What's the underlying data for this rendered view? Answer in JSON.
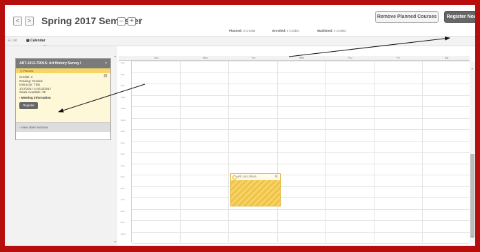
{
  "header": {
    "prev_label": "<",
    "next_label": ">",
    "title": "Spring 2017 Semester",
    "collapse_label": "–",
    "add_label": "+",
    "stats": [
      {
        "label": "Planned:",
        "value": "3 Credits"
      },
      {
        "label": "Enrolled:",
        "value": "0 Credits"
      },
      {
        "label": "Waitlisted:",
        "value": "0 Credits"
      }
    ],
    "remove_planned": "Remove Planned Courses",
    "register_now": "Register Now"
  },
  "tabs": {
    "list": "List",
    "calendar": "Calendar"
  },
  "course_card": {
    "title": "ART-1013-TR01S: Art History Survey I",
    "close": "×",
    "status": "Planned",
    "credits": "Credits: 3",
    "grading": "Grading: Graded",
    "instructor": "Instructor: TBD",
    "dates": "1/17/2017 to 5/13/2017",
    "seats": "Seats Available: 35",
    "meeting_info": "Meeting Information",
    "register": "Register",
    "view_other": "View other sections"
  },
  "calendar": {
    "days": [
      "Sun",
      "Mon",
      "Tue",
      "Wed",
      "Thu",
      "Fri",
      "Sat"
    ],
    "times": [
      "7am",
      "8am",
      "9am",
      "10am",
      "11am",
      "12pm",
      "1pm",
      "2pm",
      "3pm",
      "4pm",
      "5pm",
      "6pm",
      "7pm",
      "8pm",
      "9pm",
      "10pm",
      "11pm"
    ],
    "event_label": "ART-1013-TR01S"
  },
  "colors": {
    "frame": "#b80d0d",
    "event": "#f6d36a",
    "planned": "#f5d566"
  }
}
